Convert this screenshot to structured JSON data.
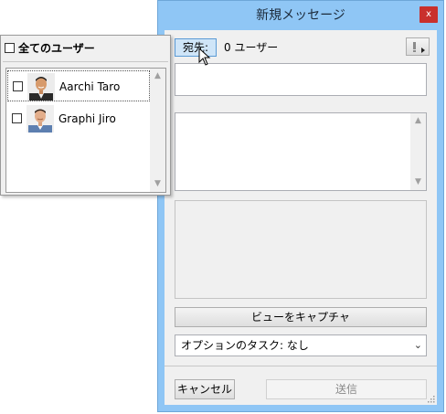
{
  "window": {
    "title": "新規メッセージ",
    "close_label": "x",
    "to_button_label": "宛先:",
    "user_count_text": "0 ユーザー",
    "capture_button_label": "ビューをキャプチャ",
    "task_select_value": "オプションのタスク: なし",
    "cancel_button_label": "キャンセル",
    "send_button_label": "送信"
  },
  "user_panel": {
    "select_all_label": "全てのユーザー",
    "users": [
      {
        "name": "Aarchi Taro",
        "checked": false,
        "selected": true,
        "avatar": "male-avatar-smiling"
      },
      {
        "name": "Graphi Jiro",
        "checked": false,
        "selected": false,
        "avatar": "male-avatar"
      }
    ]
  },
  "colors": {
    "window_frame": "#8fc6f5",
    "close_button": "#c9302c",
    "to_button_highlight": "#cfe5f8"
  }
}
